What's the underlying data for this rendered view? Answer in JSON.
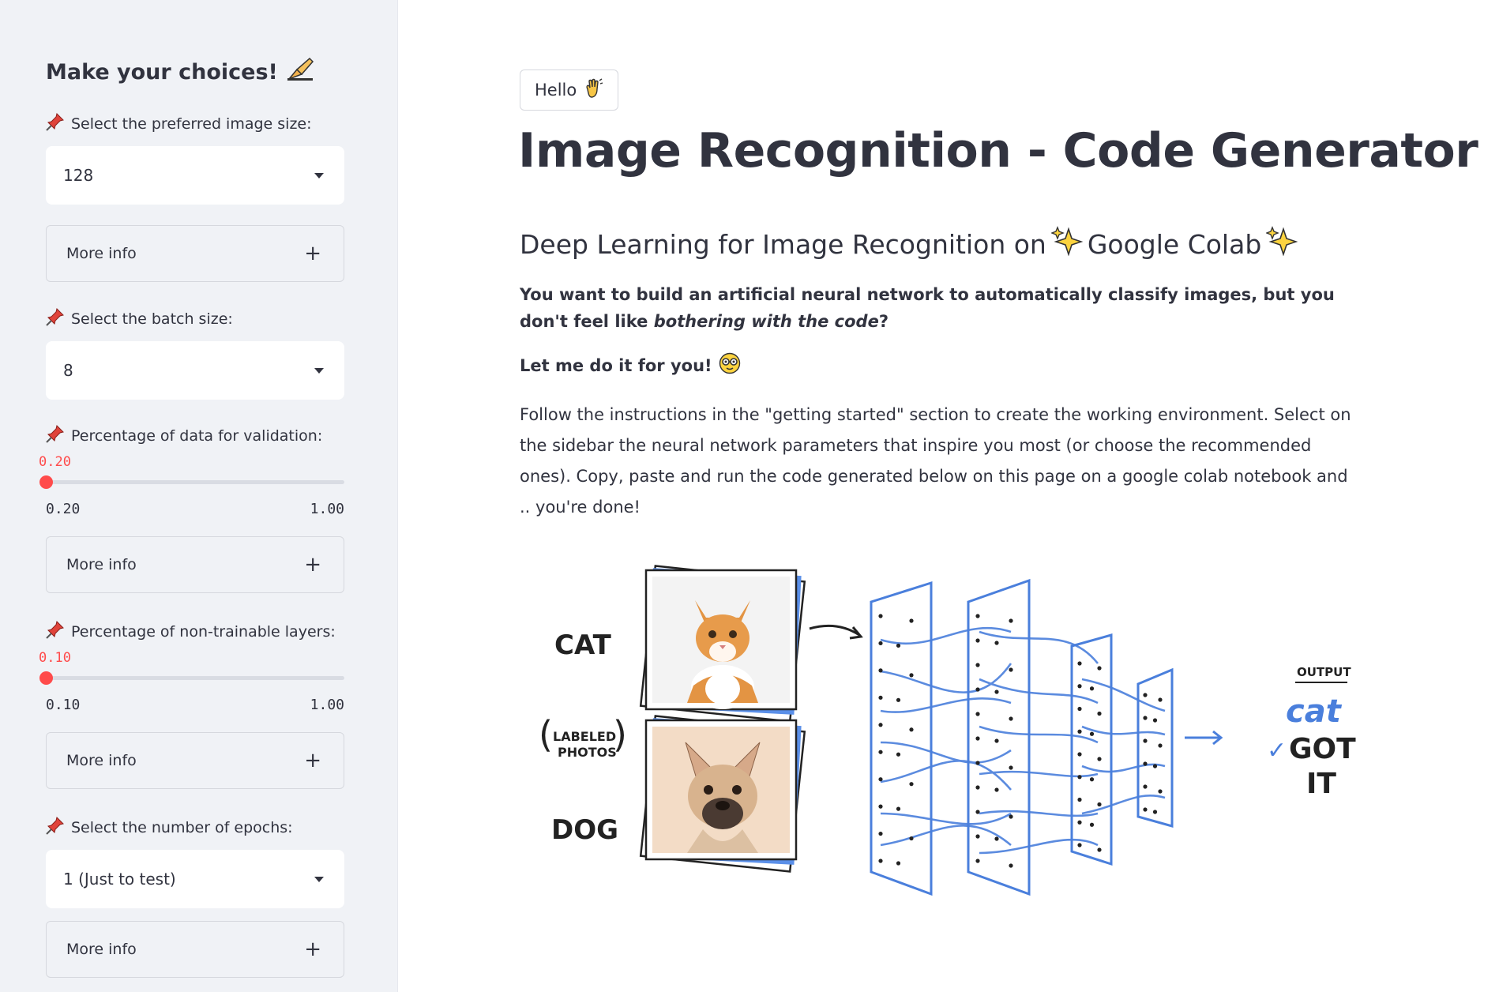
{
  "sidebar": {
    "title": "Make your choices!",
    "image_size": {
      "label": "Select the preferred image size:",
      "value": "128"
    },
    "batch_size": {
      "label": "Select the batch size:",
      "value": "8"
    },
    "validation": {
      "label": "Percentage of data for validation:",
      "value": "0.20",
      "min": "0.20",
      "max": "1.00",
      "fraction": 0.0
    },
    "non_trainable": {
      "label": "Percentage of non-trainable layers:",
      "value": "0.10",
      "min": "0.10",
      "max": "1.00",
      "fraction": 0.0
    },
    "epochs": {
      "label": "Select the number of epochs:",
      "value": "1 (Just to test)"
    },
    "more_info_label": "More info"
  },
  "main": {
    "hello_button": "Hello",
    "title": "Image Recognition - Code Generator",
    "subtitle_prefix": "Deep Learning for Image Recognition on",
    "subtitle_brand": "Google Colab",
    "intro_1": "You want to build an artificial neural network to automatically classify images, but you don't feel like",
    "intro_2_italic": "bothering with the code",
    "intro_2_end": "?",
    "let_me": "Let me do it for you!",
    "instructions": "Follow the instructions in the \"getting started\" section to create the working environment. Select on the sidebar the neural network parameters that inspire you most (or choose the recommended ones). Copy, paste and run the code generated below on this page on a google colab notebook and .. you're done!"
  },
  "illustration": {
    "cat_label": "CAT",
    "labeled_1": "LABELED",
    "labeled_2": "PHOTOS",
    "dog_label": "DOG",
    "output_label": "OUTPUT",
    "output_value": "cat",
    "got_1": "GOT",
    "got_2": "IT",
    "check": "✓"
  },
  "colors": {
    "accent": "#ff4b4b",
    "sidebar_bg": "#f0f2f6",
    "text": "#31333f",
    "net_blue": "#4a7fdc"
  }
}
